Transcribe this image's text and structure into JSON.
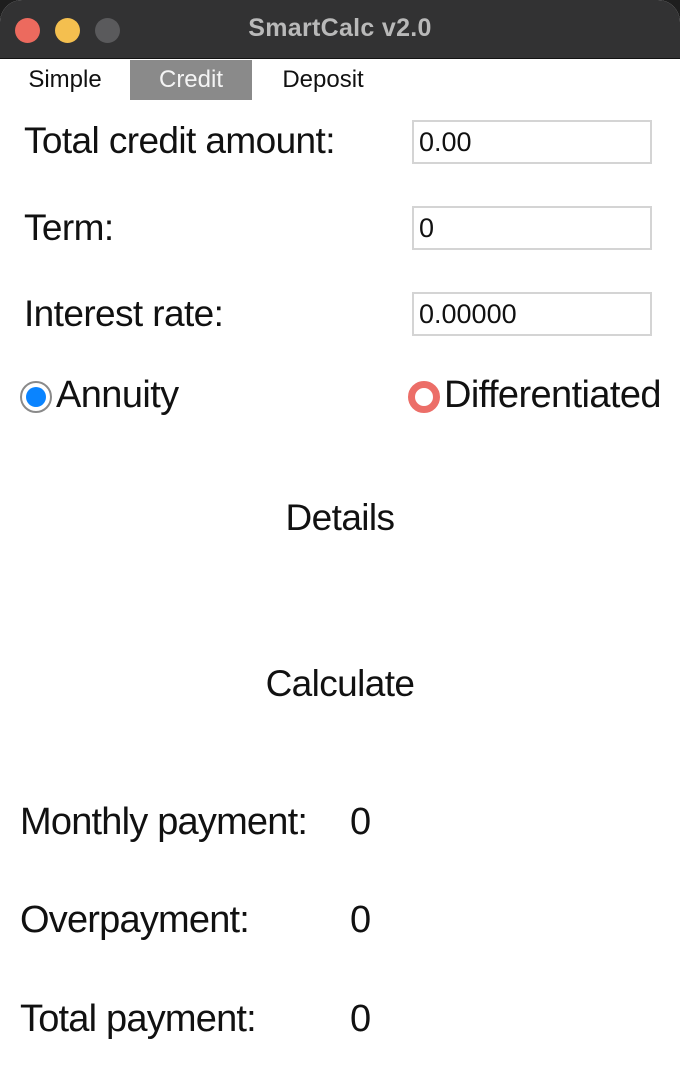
{
  "window": {
    "title": "SmartCalc v2.0"
  },
  "tabs": [
    {
      "label": "Simple"
    },
    {
      "label": "Credit"
    },
    {
      "label": "Deposit"
    }
  ],
  "form": {
    "total_credit_amount_label": "Total credit amount:",
    "total_credit_amount_value": "0.00",
    "term_label": "Term:",
    "term_value": "0",
    "interest_rate_label": "Interest rate:",
    "interest_rate_value": "0.00000"
  },
  "payment_type": {
    "annuity_label": "Annuity",
    "differentiated_label": "Differentiated",
    "selected": "Annuity"
  },
  "buttons": {
    "details_label": "Details",
    "calculate_label": "Calculate"
  },
  "results": {
    "monthly_payment_label": "Monthly payment:",
    "monthly_payment_value": "0",
    "overpayment_label": "Overpayment:",
    "overpayment_value": "0",
    "total_payment_label": "Total payment:",
    "total_payment_value": "0"
  },
  "colors": {
    "titlebar": "#323233",
    "close": "#ec6a5e",
    "minimize": "#f4bf4f",
    "zoom": "#5a5a5c",
    "active_tab": "#8a8a8a",
    "radio_selected": "#0a84ff",
    "radio_focus_ring": "#ec6e68"
  }
}
